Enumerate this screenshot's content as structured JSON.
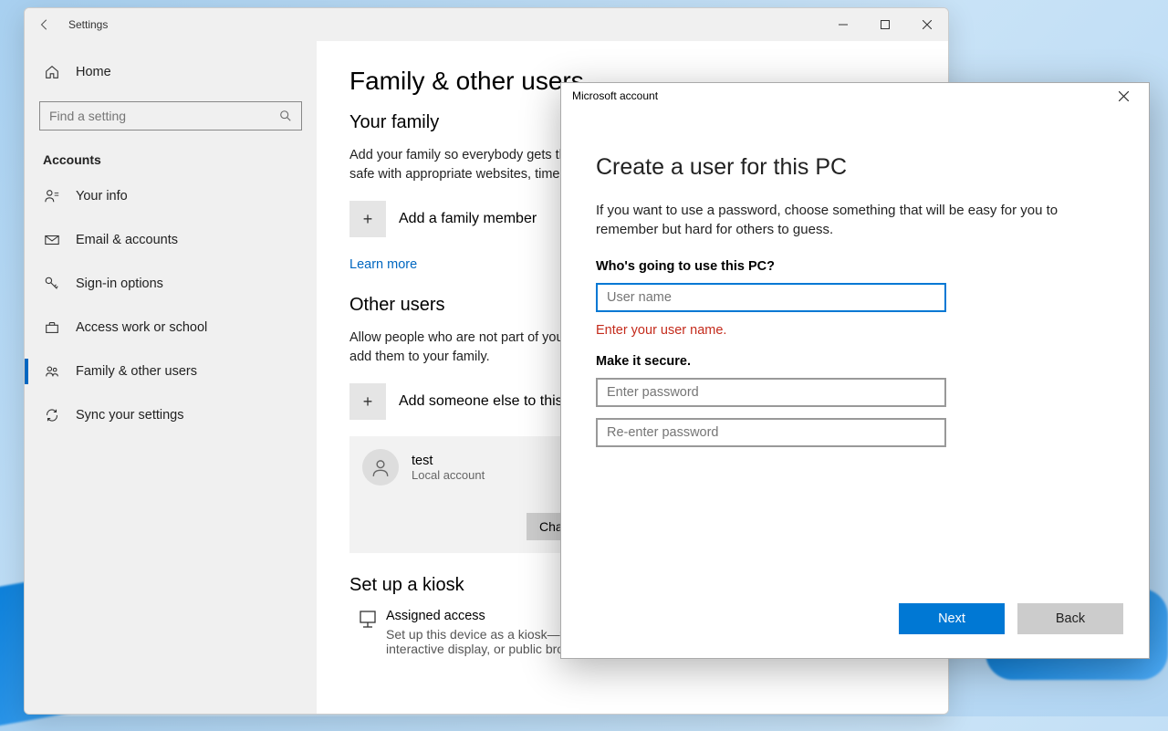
{
  "settings": {
    "windowTitle": "Settings",
    "searchPlaceholder": "Find a setting",
    "sectionLabel": "Accounts",
    "homeLabel": "Home",
    "sidebar": [
      {
        "label": "Your info"
      },
      {
        "label": "Email & accounts"
      },
      {
        "label": "Sign-in options"
      },
      {
        "label": "Access work or school"
      },
      {
        "label": "Family & other users"
      },
      {
        "label": "Sync your settings"
      }
    ],
    "content": {
      "heading": "Family & other users",
      "familyHeading": "Your family",
      "familyDesc": "Add your family so everybody gets their own sign-in and desktop. You can help kids stay safe with appropriate websites, time limits, apps, and games.",
      "addFamily": "Add a family member",
      "learnMore": "Learn more",
      "otherHeading": "Other users",
      "otherDesc": "Allow people who are not part of your family to sign in with their own accounts. This won't add them to your family.",
      "addOther": "Add someone else to this PC",
      "userName": "test",
      "userSub": "Local account",
      "changeBtn": "Change account type",
      "kioskHeading": "Set up a kiosk",
      "kioskTitle": "Assigned access",
      "kioskDesc": "Set up this device as a kiosk—this could be a digital sign, interactive display, or public browser, among other things."
    }
  },
  "modal": {
    "title": "Microsoft account",
    "heading": "Create a user for this PC",
    "desc": "If you want to use a password, choose something that will be easy for you to remember but hard for others to guess.",
    "q1": "Who's going to use this PC?",
    "usernamePlaceholder": "User name",
    "error": "Enter your user name.",
    "q2": "Make it secure.",
    "pw1Placeholder": "Enter password",
    "pw2Placeholder": "Re-enter password",
    "next": "Next",
    "back": "Back"
  }
}
